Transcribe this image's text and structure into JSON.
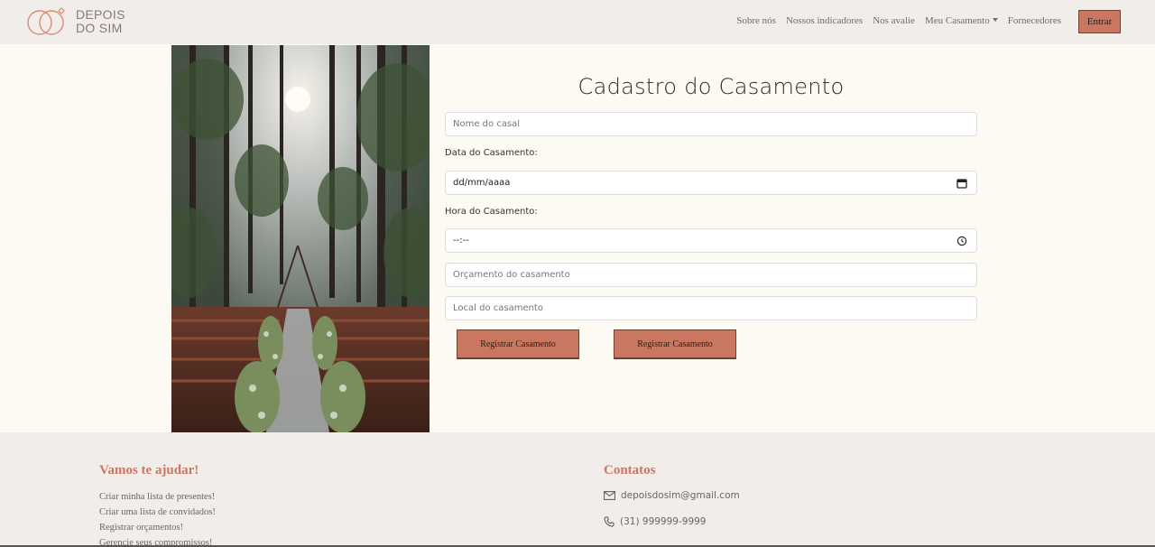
{
  "brand": {
    "line1": "DEPOIS",
    "line2": "DO SIM"
  },
  "nav": {
    "items": [
      "Sobre nós",
      "Nossos indicadores",
      "Nos avalie",
      "Meu Casamento",
      "Fornecedores"
    ],
    "login_label": "Entrar"
  },
  "form": {
    "title": "Cadastro do Casamento",
    "couple_name_placeholder": "Nome do casal",
    "date_label": "Data do Casamento:",
    "date_value": "dd/mm/aaaa",
    "time_label": "Hora do Casamento:",
    "time_value": "--:--",
    "budget_placeholder": "Orçamento do casamento",
    "location_placeholder": "Local do casamento",
    "submit_label_1": "Registrar Casamento",
    "submit_label_2": "Registrar Casamento"
  },
  "footer": {
    "help_title": "Vamos te ajudar!",
    "help_links": [
      "Criar minha lista de presentes!",
      "Criar uma lista de convidados!",
      "Registrar orçamentos!",
      "Gerencie seus compromissos!"
    ],
    "contacts_title": "Contatos",
    "email": "depoisdosim@gmail.com",
    "phone": "(31) 999999-9999"
  },
  "colors": {
    "accent": "#c97760",
    "navbar_bg": "#f1edea",
    "page_bg": "#fdf9f3"
  }
}
